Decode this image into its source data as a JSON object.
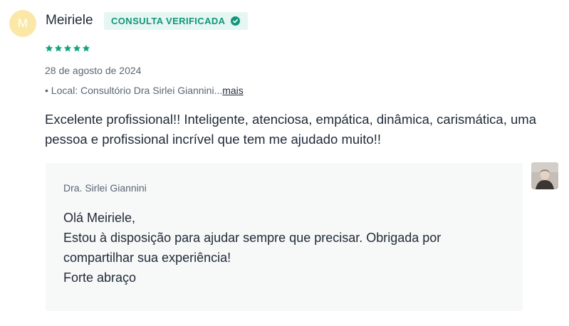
{
  "review": {
    "avatar_initial": "M",
    "author_name": "Meiriele",
    "badge_label": "CONSULTA VERIFICADA",
    "rating": 5,
    "rating_max": 5,
    "date": "28 de agosto de 2024",
    "location_prefix": "• Local: Consultório Dra Sirlei Giannini...",
    "location_more": "mais",
    "text": "Excelente profissional!! Inteligente, atenciosa, empática, dinâmica, carismática, uma pessoa e profissional incrível que tem me ajudado muito!!"
  },
  "reply": {
    "author": "Dra. Sirlei Giannini",
    "lines": [
      "Olá Meiriele,",
      "Estou à disposição para ajudar sempre que precisar. Obrigada por",
      "compartilhar sua experiência!",
      "Forte abraço"
    ]
  },
  "colors": {
    "accent": "#11967b",
    "badge_bg": "#e6f6f2",
    "star": "#11a37f",
    "avatar_bg": "#fbe8a6",
    "reply_bg": "#f7f8f8"
  },
  "icons": {
    "badge_icon": "check-circle-icon",
    "rating_icon": "star-icon"
  }
}
